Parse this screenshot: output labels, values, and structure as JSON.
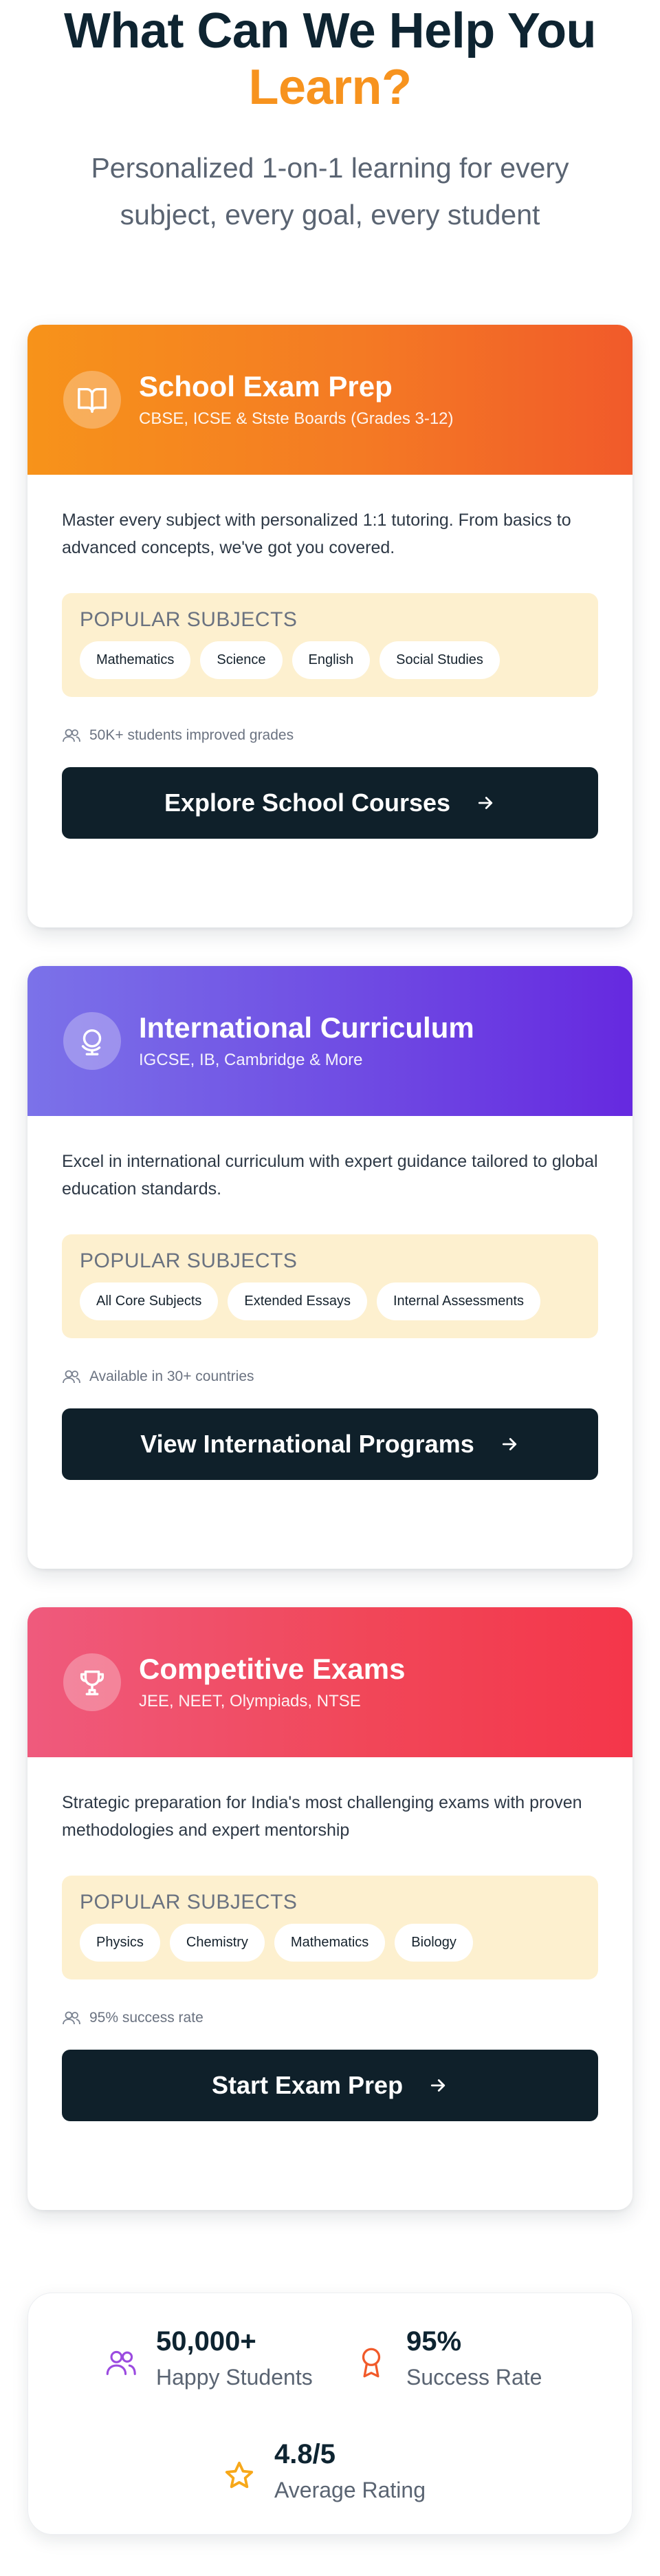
{
  "hero": {
    "title_line1": "What Can We Help You",
    "title_accent": "Learn?",
    "subtitle": "Personalized 1-on-1 learning for every subject, every goal, every student"
  },
  "colors": {
    "accent_orange": "#f7931e",
    "dark_navy": "#0f202a",
    "subjects_bg": "#fdf0cf"
  },
  "cards": [
    {
      "icon": "book-icon",
      "title": "School Exam Prep",
      "subtitle": "CBSE, ICSE & Stste Boards (Grades 3-12)",
      "description": "Master every subject with personalized 1:1 tutoring. From basics to advanced concepts, we've got you covered.",
      "subjects_label": "POPULAR SUBJECTS",
      "subjects": [
        "Mathematics",
        "Science",
        "English",
        "Social Studies"
      ],
      "meta": "50K+ students improved grades",
      "cta": "Explore School Courses"
    },
    {
      "icon": "globe-icon",
      "title": "International Curriculum",
      "subtitle": "IGCSE, IB, Cambridge & More",
      "description": "Excel in international curriculum with expert guidance tailored to global education standards.",
      "subjects_label": "POPULAR SUBJECTS",
      "subjects": [
        "All Core Subjects",
        "Extended Essays",
        "Internal Assessments"
      ],
      "meta": "Available in 30+ countries",
      "cta": "View International Programs"
    },
    {
      "icon": "trophy-icon",
      "title": "Competitive Exams",
      "subtitle": "JEE, NEET, Olympiads, NTSE",
      "description": "Strategic preparation for India's most challenging exams with proven methodologies and expert mentorship",
      "subjects_label": "POPULAR SUBJECTS",
      "subjects": [
        "Physics",
        "Chemistry",
        "Mathematics",
        "Biology"
      ],
      "meta": "95% success rate",
      "cta": "Start Exam Prep"
    }
  ],
  "stats": [
    {
      "icon": "users-icon",
      "value": "50,000+",
      "label": "Happy Students",
      "color": "#9b4be0"
    },
    {
      "icon": "award-icon",
      "value": "95%",
      "label": "Success Rate",
      "color": "#f15a2a"
    },
    {
      "icon": "star-icon",
      "value": "4.8/5",
      "label": "Average Rating",
      "color": "#f7a81a"
    }
  ]
}
